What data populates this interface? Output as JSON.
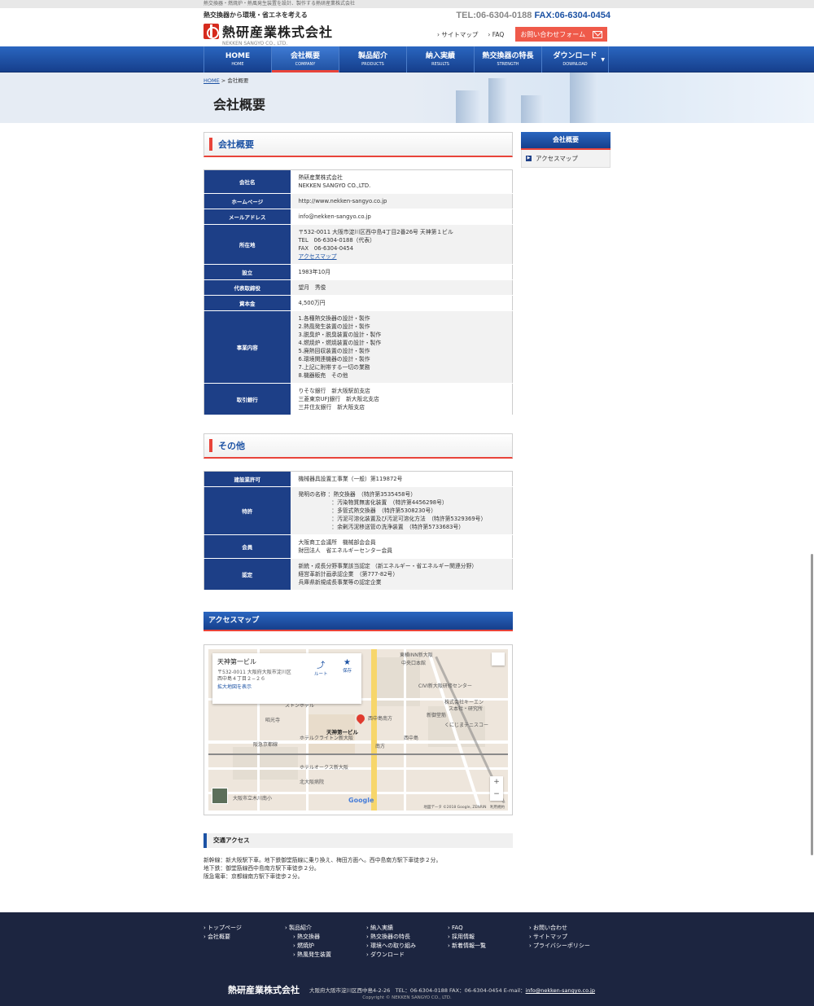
{
  "topbar": {
    "text": "熱交換器・燃焼炉・熱風発生装置を設計、製作する熱研産業株式会社"
  },
  "logo": {
    "tagline": "熱交換器から環境・省エネを考える",
    "name": "熱研産業株式会社",
    "name_en": "NEKKEN SANGYO CO., LTD."
  },
  "contact": {
    "tel": "TEL:06-6304-0188",
    "fax": "FAX:06-6304-0454"
  },
  "header_nav": {
    "sitemap": "サイトマップ",
    "faq": "FAQ",
    "contact_button": "お問い合わせフォーム"
  },
  "global_nav": [
    {
      "jp": "HOME",
      "en": "HOME"
    },
    {
      "jp": "会社概要",
      "en": "COMPANY"
    },
    {
      "jp": "製品紹介",
      "en": "PRODUCTS"
    },
    {
      "jp": "納入実績",
      "en": "RESULTS"
    },
    {
      "jp": "熱交換器の特長",
      "en": "STRENGTH"
    },
    {
      "jp": "ダウンロード",
      "en": "DOWNLOAD"
    }
  ],
  "breadcrumb": {
    "home": "HOME",
    "sep": " > ",
    "current": "会社概要"
  },
  "page_title": "会社概要",
  "section1": {
    "title": "会社概要",
    "rows": [
      {
        "label": "会社名",
        "lines": [
          "熱研産業株式会社",
          "NEKKEN SANGYO CO.,LTD."
        ]
      },
      {
        "label": "ホームページ",
        "lines": [
          "http://www.nekken-sangyo.co.jp"
        ]
      },
      {
        "label": "メールアドレス",
        "lines": [
          "info@nekken-sangyo.co.jp"
        ]
      },
      {
        "label": "所在地",
        "lines": [
          "〒532-0011 大阪市淀川区西中島4丁目2番26号 天神第１ビル",
          "TEL　06-6304-0188（代表）",
          "FAX　06-6304-0454"
        ],
        "link": "アクセスマップ"
      },
      {
        "label": "設立",
        "lines": [
          "1983年10月"
        ]
      },
      {
        "label": "代表取締役",
        "lines": [
          "望月　秀俊"
        ]
      },
      {
        "label": "資本金",
        "lines": [
          "4,500万円"
        ]
      },
      {
        "label": "事業内容",
        "lines": [
          "1.各種熱交換器の設計・製作",
          "2.熱風発生装置の設計・製作",
          "3.脱臭炉・脱臭装置の設計・製作",
          "4.燃焼炉・燃焼装置の設計・製作",
          "5.廃熱回収装置の設計・製作",
          "6.環境関連機器の設計・製作",
          "7.上記に附帯する一切の業務",
          "8.機器販売　その他"
        ]
      },
      {
        "label": "取引銀行",
        "lines": [
          "りそな銀行　新大阪駅前支店",
          "三菱東京UFJ銀行　新大阪北支店",
          "三井住友銀行　新大阪支店"
        ]
      }
    ]
  },
  "section2": {
    "title": "その他",
    "rows": [
      {
        "label": "建設業許可",
        "lines": [
          "機械器具設置工事業（一般）第119872号"
        ]
      },
      {
        "label": "特許",
        "lines": [
          "発明の名称 ：熱交換器　（特許第3535458号）",
          "　　　　　　：汚染物質無害化装置　（特許第4456298号）",
          "　　　　　　：多管式熱交換器　（特許第5308230号）",
          "　　　　　　：汚泥可溶化装置及び汚泥可溶化方法　（特許第5329369号）",
          "　　　　　　：余剰汚泥移送管の洗浄装置　（特許第5733683号）"
        ]
      },
      {
        "label": "会員",
        "lines": [
          "大阪商工会議所　機械部会会員",
          "財団法人　省エネルギーセンター会員"
        ]
      },
      {
        "label": "認定",
        "lines": [
          "新統・成長分野事業該当認定 （新エネルギー・省エネルギー関連分野）",
          "経営革新計画承認企業　（第777-82号）",
          "兵庫県新規成長事業等の認定企業"
        ]
      }
    ]
  },
  "access": {
    "title": "アクセスマップ",
    "map": {
      "place_name": "天神第一ビル",
      "address": "〒532-0011 大阪府大阪市淀川区西中島４丁目２−２６",
      "route_label": "ルート",
      "save_label": "保存",
      "larger_map": "拡大地図を表示",
      "pin_label": "天神第一ビル",
      "attribution": "地図データ ©2018 Google, ZENRIN　利用規約",
      "google": "Google",
      "labels": [
        "東横INN新大阪",
        "中央口本館",
        "CIVI新大阪研修センター",
        "株式会社キーエン",
        "ス本社・研究所",
        "新大阪サニー",
        "ストンホテル",
        "ホテルクライトン新大阪",
        "西中島",
        "阪急京都線",
        "ホテルオークス新大阪",
        "北大阪病院",
        "大阪市立木川南小",
        "西中島南方",
        "南方",
        "昭光寺",
        "くにじまテニスコー",
        "新御堂筋"
      ]
    },
    "traffic_title": "交通アクセス",
    "traffic_lines": [
      "新幹線：新大阪駅下車。地下鉄御堂筋線に乗り換え、梅田方面へ。西中島南方駅下車徒歩２分。",
      "地下鉄：御堂筋線西中島南方駅下車徒歩２分。",
      "阪急電車：京都線南方駅下車徒歩２分。"
    ]
  },
  "sidebar": {
    "title": "会社概要",
    "item": "アクセスマップ"
  },
  "footer": {
    "cols": [
      {
        "items": [
          "トップページ",
          "会社概要"
        ]
      },
      {
        "items": [
          "製品紹介"
        ],
        "subs": [
          "熱交換器",
          "燃焼炉",
          "熱風発生装置"
        ]
      },
      {
        "items": [
          "納入実績",
          "熱交換器の特長",
          "環境への取り組み",
          "ダウンロード"
        ]
      },
      {
        "items": [
          "FAQ",
          "採用情報",
          "新着情報一覧"
        ]
      },
      {
        "items": [
          "お問い合わせ",
          "サイトマップ",
          "プライバシーポリシー"
        ]
      }
    ],
    "company": "熱研産業株式会社",
    "address": "大阪府大阪市淀川区西中島4-2-26　TEL：06-6304-0188 FAX：06-6304-0454 E-mail：",
    "email": "info@nekken-sangyo.co.jp",
    "copyright": "Copyright © NEKKEN SANGYO CO., LTD."
  },
  "colors": {
    "brand_blue": "#1c52a4",
    "nav_dark": "#1d3f87",
    "accent_red": "#e8443a",
    "footer": "#1c2540"
  }
}
